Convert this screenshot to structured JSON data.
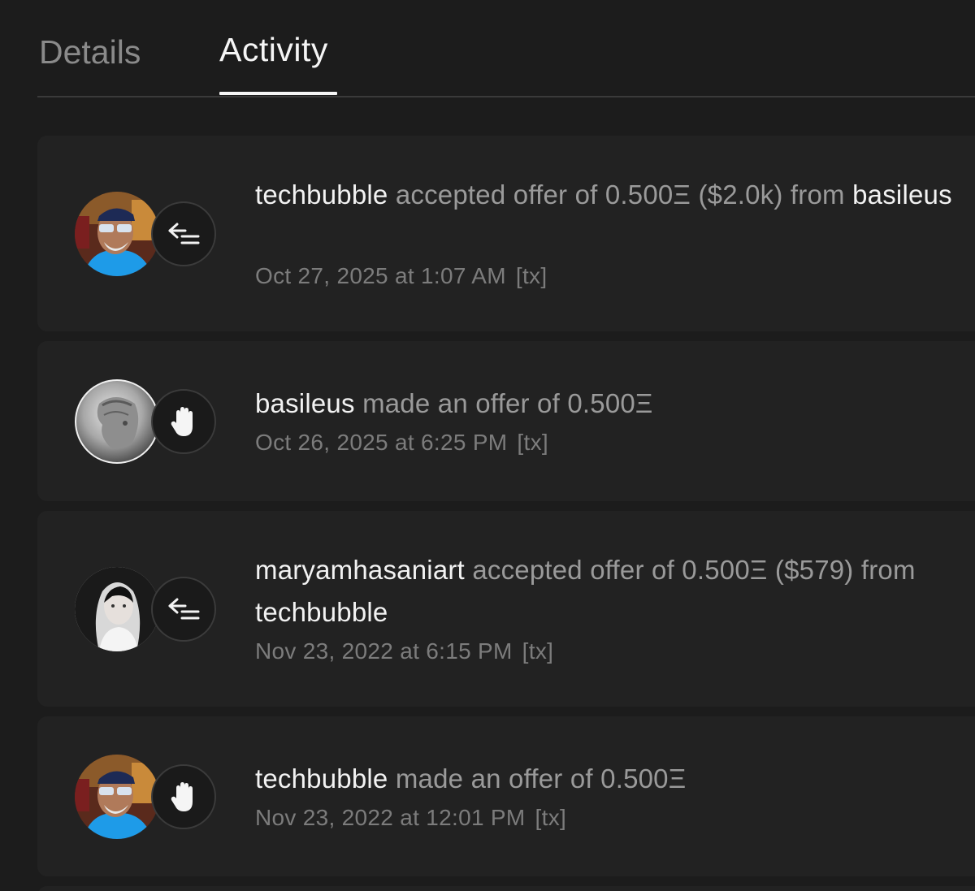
{
  "tabs": {
    "details": "Details",
    "activity": "Activity",
    "active": "activity"
  },
  "activities": [
    {
      "avatar": "techbubble-avatar",
      "event_icon": "accept-offer-icon",
      "actor": "techbubble",
      "action": "accepted offer of 0.500Ξ ($2.0k) from",
      "counterparty": "basileus",
      "timestamp": "Oct 27, 2025 at 1:07 AM",
      "tx_label": "[tx]"
    },
    {
      "avatar": "basileus-avatar",
      "event_icon": "offer-hand-icon",
      "actor": "basileus",
      "action": "made an offer of 0.500Ξ",
      "timestamp": "Oct 26, 2025 at 6:25 PM",
      "tx_label": "[tx]"
    },
    {
      "avatar": "maryamhasaniart-avatar",
      "event_icon": "accept-offer-icon",
      "actor": "maryamhasaniart",
      "action": "accepted offer of 0.500Ξ ($579) from",
      "counterparty": "techbubble",
      "timestamp": "Nov 23, 2022 at 6:15 PM",
      "tx_label": "[tx]"
    },
    {
      "avatar": "techbubble-avatar",
      "event_icon": "offer-hand-icon",
      "actor": "techbubble",
      "action": "made an offer of 0.500Ξ",
      "timestamp": "Nov 23, 2022 at 12:01 PM",
      "tx_label": "[tx]"
    }
  ],
  "colors": {
    "background": "#1c1c1c",
    "card": "#222222",
    "primary_text": "#f2f2f2",
    "secondary_text": "#9a9a9a",
    "muted_text": "#7c7c7c"
  }
}
